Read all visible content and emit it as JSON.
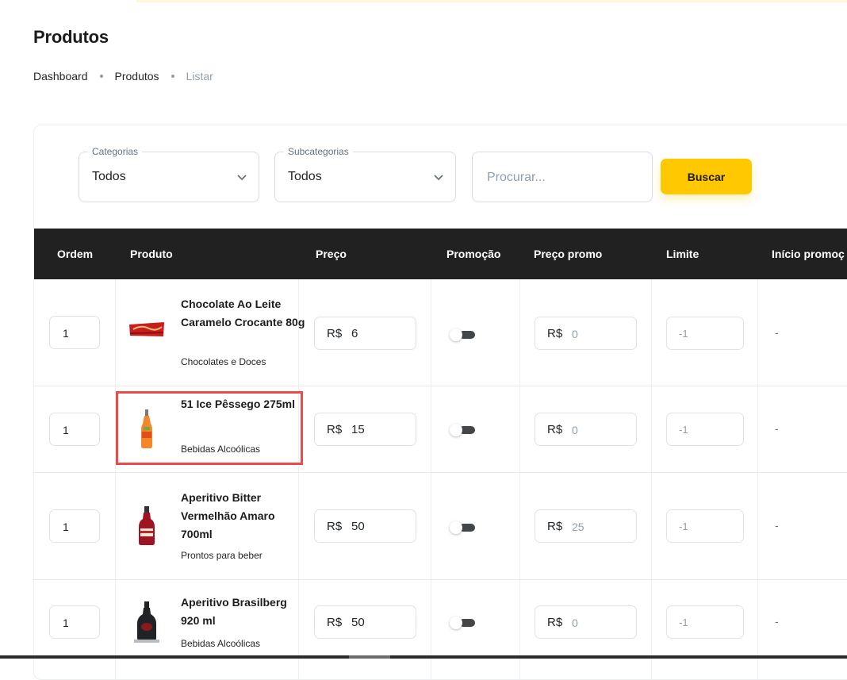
{
  "page": {
    "title": "Produtos"
  },
  "breadcrumb": [
    "Dashboard",
    "Produtos",
    "Listar"
  ],
  "filters": {
    "categories": {
      "label": "Categorias",
      "value": "Todos"
    },
    "subcategories": {
      "label": "Subcategorias",
      "value": "Todos"
    },
    "search_placeholder": "Procurar...",
    "search_button": "Buscar"
  },
  "table": {
    "headers": [
      "Ordem",
      "Produto",
      "Preço",
      "Promoção",
      "Preço promo",
      "Limite",
      "Início promoç"
    ],
    "rows": [
      {
        "order": "1",
        "name": "Chocolate Ao Leite Caramelo Crocante 80g",
        "category": "Chocolates e Doces",
        "currency": "R$",
        "price": "6",
        "promo_active": false,
        "promo_price": "0",
        "limit": "-1",
        "promo_start": "-"
      },
      {
        "order": "1",
        "name": "51 Ice Pêssego 275ml",
        "category": "Bebidas Alcoólicas",
        "currency": "R$",
        "price": "15",
        "promo_active": false,
        "promo_price": "0",
        "limit": "-1",
        "promo_start": "-"
      },
      {
        "order": "1",
        "name": "Aperitivo Bitter Vermelhão Amaro 700ml",
        "category": "Prontos para beber",
        "currency": "R$",
        "price": "50",
        "promo_active": false,
        "promo_price": "25",
        "limit": "-1",
        "promo_start": "-"
      },
      {
        "order": "1",
        "name": "Aperitivo Brasilberg 920 ml",
        "category": "Bebidas Alcoólicas",
        "currency": "R$",
        "price": "50",
        "promo_active": false,
        "promo_price": "0",
        "limit": "-1",
        "promo_start": "-"
      }
    ]
  },
  "colors": {
    "accent": "#ffc800",
    "header_bg": "#212121",
    "highlight": "#ef4a4a"
  },
  "icons": {
    "select": "chevron-down-icon",
    "toggle": "toggle-switch"
  }
}
